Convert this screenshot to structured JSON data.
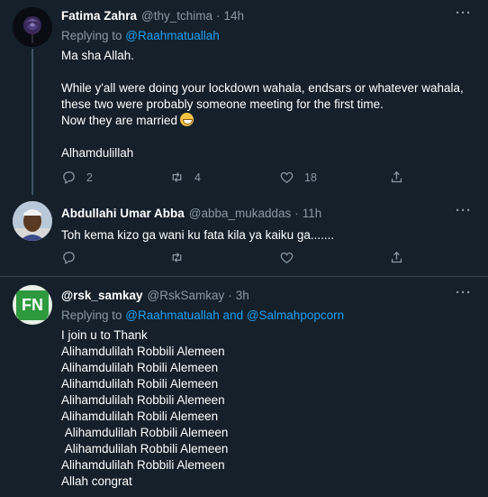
{
  "colors": {
    "background": "#15202b",
    "link": "#1da1f2",
    "muted": "#8899a6",
    "divider": "#38444d"
  },
  "tweets": [
    {
      "name": "Fatima Zahra",
      "handle": "@thy_tchima",
      "time": "14h",
      "replying_prefix": "Replying to ",
      "replying_to": "@Raahmatuallah",
      "body_line1": "Ma sha Allah.",
      "body_para2": "While y'all were doing your lockdown wahala, endsars or whatever wahala,\nthese two were probably someone meeting for the first time.\nNow they are married",
      "body_line3": "Alhamdulillah",
      "emoji": "grinning-face-emoji",
      "replies": "2",
      "retweets": "4",
      "likes": "18"
    },
    {
      "name": "Abdullahi Umar Abba",
      "handle": "@abba_mukaddas",
      "time": "11h",
      "body": "Toh kema kizo ga wani ku fata kila ya kaiku ga......."
    },
    {
      "name": "@rsk_samkay",
      "handle": "@RskSamkay",
      "time": "3h",
      "replying_prefix": "Replying to ",
      "replying_to": "@Raahmatuallah and @Salmahpopcorn",
      "body": "I join u to Thank\nAlihamdulilah Robbili Alemeen\nAlihamdulilah Robili Alemeen\nAlihamdulilah Robili Alemeen\nAlihamdulilah Robbili Alemeen\nAlihamdulilah Robili Alemeen\n Alihamdulilah Robbili Alemeen\n Alihamdulilah Robbili Alemeen\nAlihamdulilah Robbili Alemeen\nAllah congrat",
      "avatar_text": "FN"
    }
  ],
  "more_label": "···"
}
